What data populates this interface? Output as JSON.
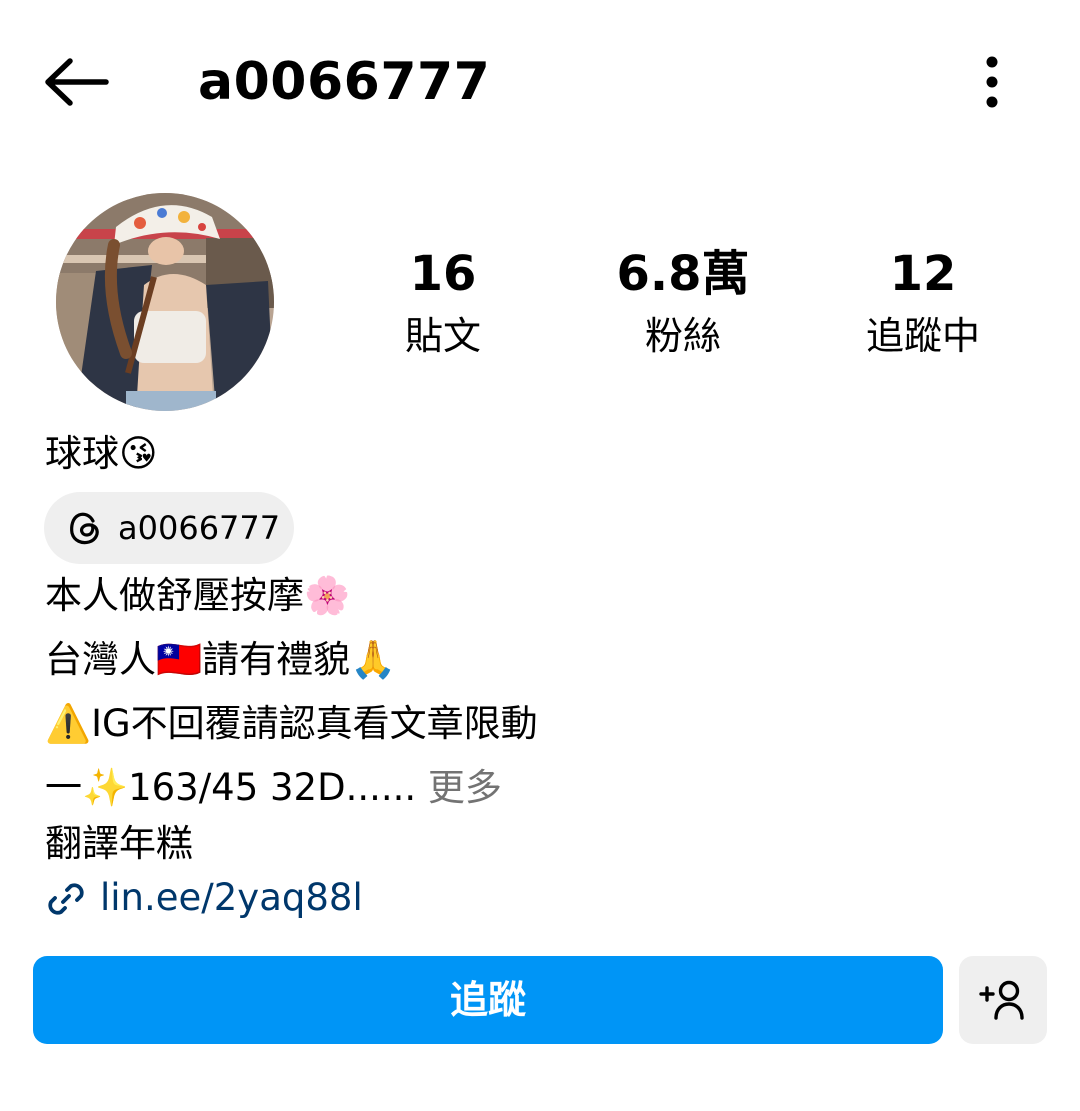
{
  "header": {
    "username": "a0066777",
    "back_icon": "arrow-left-icon",
    "menu_icon": "more-vertical-icon"
  },
  "profile": {
    "stats": [
      {
        "value": "16",
        "label": "貼文"
      },
      {
        "value": "6.8萬",
        "label": "粉絲"
      },
      {
        "value": "12",
        "label": "追蹤中"
      }
    ],
    "display_name": "球球😘",
    "threads_handle": "a0066777",
    "bio_lines": [
      "本人做舒壓按摩🌸",
      "台灣人🇹🇼請有禮貌🙏",
      "⚠️IG不回覆請認真看文章限動",
      "一✨163/45 32D......"
    ],
    "bio_more": "更多",
    "translate": "翻譯年糕",
    "link": "lin.ee/2yaq88l"
  },
  "actions": {
    "follow_label": "追蹤",
    "suggest_icon": "add-person-icon"
  },
  "colors": {
    "accent": "#0095f6",
    "link": "#00376b",
    "muted": "#737373",
    "chip_bg": "#efefef"
  }
}
